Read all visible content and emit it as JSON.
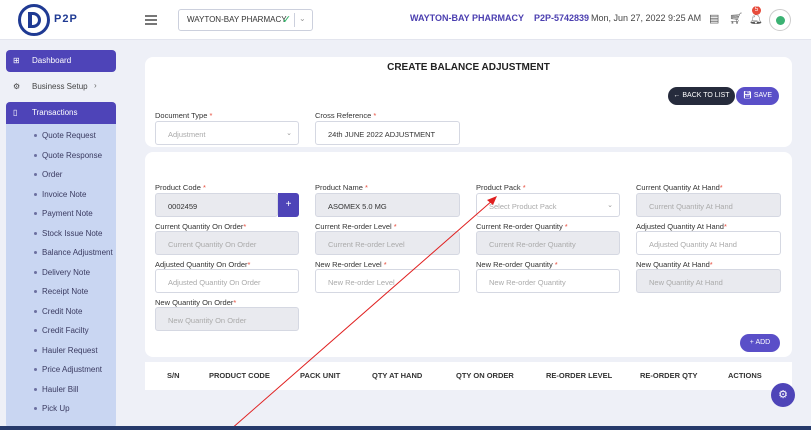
{
  "header": {
    "logo_text": "P2P",
    "pharmacy_select": "WAYTON-BAY PHARMACY",
    "pharmacy_name": "WAYTON-BAY PHARMACY",
    "pharmacy_code": "P2P-5742839",
    "datetime": "Mon, Jun 27, 2022 9:25 AM",
    "notification_count": "5"
  },
  "sidebar": {
    "dashboard": "Dashboard",
    "business_setup": "Business Setup",
    "transactions": "Transactions",
    "items": [
      {
        "label": "Quote Request"
      },
      {
        "label": "Quote Response"
      },
      {
        "label": "Order"
      },
      {
        "label": "Invoice Note"
      },
      {
        "label": "Payment Note"
      },
      {
        "label": "Stock Issue Note"
      },
      {
        "label": "Balance Adjustment"
      },
      {
        "label": "Delivery Note"
      },
      {
        "label": "Receipt Note"
      },
      {
        "label": "Credit Note"
      },
      {
        "label": "Credit Facilty"
      },
      {
        "label": "Hauler Request"
      },
      {
        "label": "Price Adjustment"
      },
      {
        "label": "Hauler Bill"
      },
      {
        "label": "Pick Up"
      }
    ]
  },
  "form": {
    "title": "CREATE BALANCE ADJUSTMENT",
    "back_label": "BACK TO LIST",
    "save_label": "SAVE",
    "add_label": "ADD",
    "document_type": {
      "label": "Document Type",
      "value": "Adjustment"
    },
    "cross_reference": {
      "label": "Cross Reference",
      "value": "24th JUNE 2022 ADJUSTMENT"
    },
    "product_code": {
      "label": "Product Code",
      "value": "0002459"
    },
    "product_name": {
      "label": "Product Name",
      "value": "ASOMEX 5.0 MG"
    },
    "product_pack": {
      "label": "Product Pack",
      "placeholder": "Select Product Pack"
    },
    "current_qty_hand": {
      "label": "Current Quantity At Hand",
      "placeholder": "Current Quantity At Hand"
    },
    "current_qty_order": {
      "label": "Current Quantity On Order",
      "placeholder": "Current Quantity On Order"
    },
    "current_reorder_level": {
      "label": "Current Re-order Level",
      "placeholder": "Current Re-order Level"
    },
    "current_reorder_qty": {
      "label": "Current Re-order Quantity",
      "placeholder": "Current Re-order Quantity"
    },
    "adjusted_qty_hand": {
      "label": "Adjusted Quantity At Hand",
      "placeholder": "Adjusted Quantity At Hand"
    },
    "adjusted_qty_order": {
      "label": "Adjusted Quantity On Order",
      "placeholder": "Adjusted Quantity On Order"
    },
    "new_reorder_level": {
      "label": "New Re-order Level",
      "placeholder": "New Re-order Level"
    },
    "new_reorder_qty": {
      "label": "New Re-order Quantity",
      "placeholder": "New Re-order Quantity"
    },
    "new_qty_hand": {
      "label": "New Quantity At Hand",
      "placeholder": "New Quantity At Hand"
    },
    "new_qty_order": {
      "label": "New Quantity On Order",
      "placeholder": "New Quantity On Order"
    }
  },
  "table": {
    "columns": [
      "S/N",
      "PRODUCT CODE",
      "PACK UNIT",
      "QTY AT HAND",
      "QTY ON ORDER",
      "RE-ORDER LEVEL",
      "RE-ORDER QTY",
      "ACTIONS"
    ]
  },
  "colors": {
    "primary": "#4e44b8",
    "dark": "#262b3c",
    "annotation_arrow": "#e02020"
  }
}
